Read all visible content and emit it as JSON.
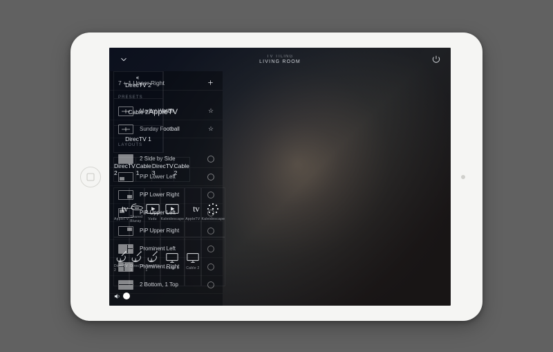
{
  "header": {
    "context": "TV TILING",
    "room": "LIVING ROOM"
  },
  "layout": {
    "side_tiles": [
      "DirecTV 2",
      "Cable 2",
      "DirecTV 1"
    ],
    "side_active_audio_index": 0,
    "main_tile": "AppleTV",
    "bottom_row": [
      "DirecTV 2",
      "Cable 1",
      "DirecTV 3",
      "Cable 2"
    ]
  },
  "sources": [
    {
      "label": "AppleTV",
      "icon": "appletv"
    },
    {
      "label": "Shared Bluray",
      "icon": "bluray"
    },
    {
      "label": "Vudu",
      "icon": "play-box"
    },
    {
      "label": "Kaleidescape",
      "icon": "play-box"
    },
    {
      "label": "AppleTV",
      "icon": "appletv"
    },
    {
      "label": "Kaleidescape",
      "icon": "kscape"
    },
    {
      "label": "DirecTV 2",
      "icon": "dish"
    },
    {
      "label": "DirecTV 3",
      "icon": "dish"
    },
    {
      "label": "DirecTV 1",
      "icon": "dish"
    },
    {
      "label": "Cable 1",
      "icon": "monitor"
    },
    {
      "label": "Cable 2",
      "icon": "monitor"
    }
  ],
  "volume": {
    "value": 18
  },
  "right": {
    "current": "7 + 1 Upper Right",
    "presets_label": "PRESETS",
    "layouts_label": "LAYOUTS",
    "presets": [
      {
        "label": "Market Watch"
      },
      {
        "label": "Sunday Football"
      }
    ],
    "layouts": [
      {
        "label": "2 Side by Side",
        "thumb": "sbs"
      },
      {
        "label": "PiP Lower Left",
        "thumb": "pip-ll"
      },
      {
        "label": "PiP Lower Right",
        "thumb": "pip-lr"
      },
      {
        "label": "PiP Upper Left",
        "thumb": "pip-ul"
      },
      {
        "label": "PiP Upper Right",
        "thumb": "pip-ur"
      },
      {
        "label": "Prominent Left",
        "thumb": "prom-l"
      },
      {
        "label": "Prominent Right",
        "thumb": "prom-r"
      },
      {
        "label": "2 Bottom, 1 Top",
        "thumb": "2b1t"
      }
    ]
  }
}
